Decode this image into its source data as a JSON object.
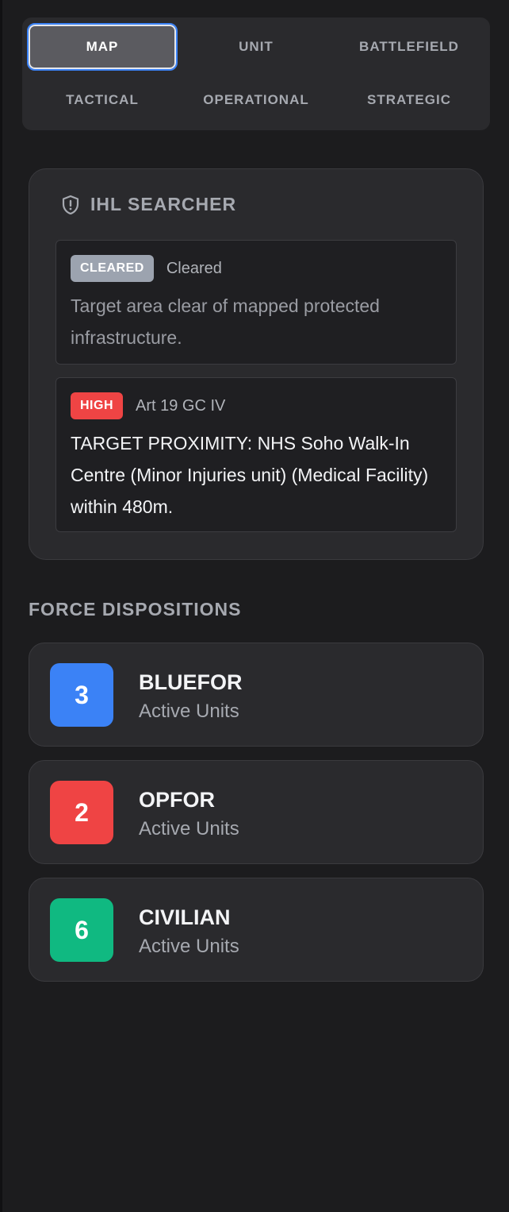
{
  "tabs": [
    {
      "label": "MAP",
      "active": true
    },
    {
      "label": "UNIT",
      "active": false
    },
    {
      "label": "BATTLEFIELD",
      "active": false
    },
    {
      "label": "TACTICAL",
      "active": false
    },
    {
      "label": "OPERATIONAL",
      "active": false
    },
    {
      "label": "STRATEGIC",
      "active": false
    }
  ],
  "ihl": {
    "title": "IHL SEARCHER",
    "icon": "shield-alert-icon",
    "findings": [
      {
        "badge": "CLEARED",
        "badge_bg": "#9ca3af",
        "badge_fg": "#ffffff",
        "ref": "Cleared",
        "message": "Target area clear of mapped protected infrastructure."
      },
      {
        "badge": "HIGH",
        "badge_bg": "#ef4444",
        "badge_fg": "#ffffff",
        "ref": "Art 19 GC IV",
        "message": "TARGET PROXIMITY: NHS Soho Walk-In Centre (Minor Injuries unit) (Medical Facility) within 480m."
      }
    ]
  },
  "forces": {
    "title": "FORCE DISPOSITIONS",
    "items": [
      {
        "count": "3",
        "name": "BLUEFOR",
        "sub": "Active Units",
        "color": "#3b82f6"
      },
      {
        "count": "2",
        "name": "OPFOR",
        "sub": "Active Units",
        "color": "#ef4444"
      },
      {
        "count": "6",
        "name": "CIVILIAN",
        "sub": "Active Units",
        "color": "#10b981"
      }
    ]
  }
}
